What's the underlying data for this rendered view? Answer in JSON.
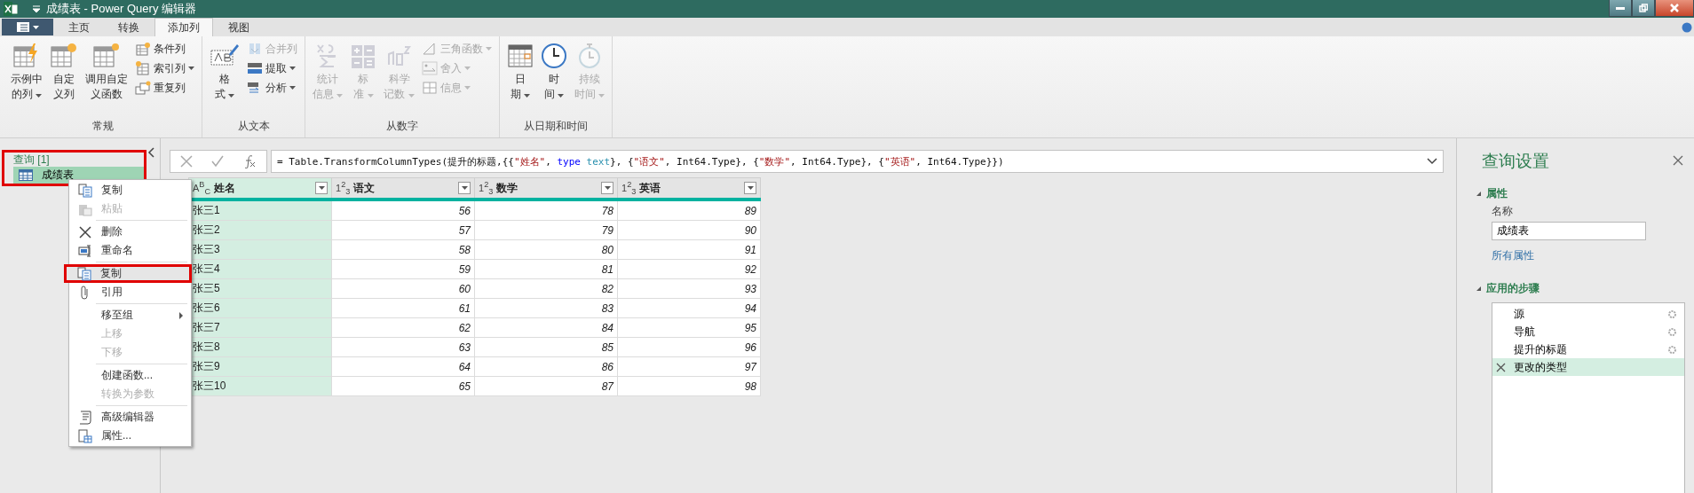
{
  "window": {
    "title": "成绩表 - Power Query 编辑器"
  },
  "ribbon_tabs": [
    {
      "label": "主页",
      "selected": false
    },
    {
      "label": "转换",
      "selected": false
    },
    {
      "label": "添加列",
      "selected": true
    },
    {
      "label": "视图",
      "selected": false
    }
  ],
  "ribbon_groups": [
    {
      "label": "常规",
      "large_buttons": [
        {
          "lines": [
            "示例中",
            "的列"
          ],
          "dropdown": true,
          "disabled": false
        },
        {
          "lines": [
            "自定",
            "义列"
          ],
          "dropdown": false,
          "disabled": false
        },
        {
          "lines": [
            "调用自定",
            "义函数"
          ],
          "dropdown": false,
          "disabled": false
        }
      ],
      "small_buttons": [
        {
          "label": "条件列",
          "dropdown": false,
          "disabled": false
        },
        {
          "label": "索引列",
          "dropdown": true,
          "disabled": false
        },
        {
          "label": "重复列",
          "dropdown": false,
          "disabled": false
        }
      ]
    },
    {
      "label": "从文本",
      "large_buttons": [
        {
          "lines": [
            "格",
            "式"
          ],
          "dropdown": true,
          "disabled": false
        }
      ],
      "small_buttons": [
        {
          "label": "合并列",
          "dropdown": false,
          "disabled": true
        },
        {
          "label": "提取",
          "dropdown": true,
          "disabled": false
        },
        {
          "label": "分析",
          "dropdown": true,
          "disabled": false
        }
      ]
    },
    {
      "label": "从数字",
      "large_buttons": [
        {
          "lines": [
            "统计",
            "信息"
          ],
          "dropdown": true,
          "disabled": true
        },
        {
          "lines": [
            "标",
            "准"
          ],
          "dropdown": true,
          "disabled": true
        },
        {
          "lines": [
            "科学",
            "记数"
          ],
          "dropdown": true,
          "disabled": true
        }
      ],
      "small_buttons": [
        {
          "label": "三角函数",
          "dropdown": true,
          "disabled": true
        },
        {
          "label": "舍入",
          "dropdown": true,
          "disabled": true
        },
        {
          "label": "信息",
          "dropdown": true,
          "disabled": true
        }
      ]
    },
    {
      "label": "从日期和时间",
      "large_buttons": [
        {
          "lines": [
            "日",
            "期"
          ],
          "dropdown": true,
          "disabled": false
        },
        {
          "lines": [
            "时",
            "间"
          ],
          "dropdown": true,
          "disabled": false
        },
        {
          "lines": [
            "持续",
            "时间"
          ],
          "dropdown": true,
          "disabled": true
        }
      ]
    }
  ],
  "queries_pane": {
    "header": "查询 [1]",
    "highlighted": true,
    "items": [
      {
        "label": "成绩表",
        "selected": true
      }
    ]
  },
  "context_menu": {
    "items": [
      {
        "kind": "item",
        "label": "复制",
        "disabled": false,
        "highlighted": false,
        "submenu": false
      },
      {
        "kind": "item",
        "label": "粘贴",
        "disabled": true,
        "highlighted": false,
        "submenu": false
      },
      {
        "kind": "separator"
      },
      {
        "kind": "item",
        "label": "删除",
        "disabled": false,
        "highlighted": false,
        "submenu": false
      },
      {
        "kind": "item",
        "label": "重命名",
        "disabled": false,
        "highlighted": false,
        "submenu": false
      },
      {
        "kind": "separator"
      },
      {
        "kind": "item",
        "label": "复制",
        "disabled": false,
        "highlighted": true,
        "submenu": false
      },
      {
        "kind": "item",
        "label": "引用",
        "disabled": false,
        "highlighted": false,
        "submenu": false
      },
      {
        "kind": "separator"
      },
      {
        "kind": "item",
        "label": "移至组",
        "disabled": false,
        "highlighted": false,
        "submenu": true
      },
      {
        "kind": "item",
        "label": "上移",
        "disabled": true,
        "highlighted": false,
        "submenu": false
      },
      {
        "kind": "item",
        "label": "下移",
        "disabled": true,
        "highlighted": false,
        "submenu": false
      },
      {
        "kind": "separator"
      },
      {
        "kind": "item",
        "label": "创建函数...",
        "disabled": false,
        "highlighted": false,
        "submenu": false
      },
      {
        "kind": "item",
        "label": "转换为参数",
        "disabled": true,
        "highlighted": false,
        "submenu": false
      },
      {
        "kind": "separator"
      },
      {
        "kind": "item",
        "label": "高级编辑器",
        "disabled": false,
        "highlighted": false,
        "submenu": false
      },
      {
        "kind": "item",
        "label": "属性...",
        "disabled": false,
        "highlighted": false,
        "submenu": false
      }
    ]
  },
  "formula_bar": {
    "segments": [
      {
        "kind": "plain",
        "text": "= Table.TransformColumnTypes(提升的标题,{{"
      },
      {
        "kind": "string",
        "text": "\"姓名\""
      },
      {
        "kind": "plain",
        "text": ", "
      },
      {
        "kind": "keyword",
        "text": "type "
      },
      {
        "kind": "typename",
        "text": "text"
      },
      {
        "kind": "plain",
        "text": "}, {"
      },
      {
        "kind": "string",
        "text": "\"语文\""
      },
      {
        "kind": "plain",
        "text": ", Int64.Type}, {"
      },
      {
        "kind": "string",
        "text": "\"数学\""
      },
      {
        "kind": "plain",
        "text": ", Int64.Type}, {"
      },
      {
        "kind": "string",
        "text": "\"英语\""
      },
      {
        "kind": "plain",
        "text": ", Int64.Type}})"
      }
    ]
  },
  "table": {
    "columns": [
      {
        "type_mark": "A$^{B}$$_{C}$",
        "label": "姓名",
        "selected": true
      },
      {
        "type_mark": "1$^{2}$$_{3}$",
        "label": "语文",
        "selected": false
      },
      {
        "type_mark": "1$^{2}$$_{3}$",
        "label": "数学",
        "selected": false
      },
      {
        "type_mark": "1$^{2}$$_{3}$",
        "label": "英语",
        "selected": false
      }
    ],
    "rows": [
      [
        "张三1",
        "56",
        "78",
        "89"
      ],
      [
        "张三2",
        "57",
        "79",
        "90"
      ],
      [
        "张三3",
        "58",
        "80",
        "91"
      ],
      [
        "张三4",
        "59",
        "81",
        "92"
      ],
      [
        "张三5",
        "60",
        "82",
        "93"
      ],
      [
        "张三6",
        "61",
        "83",
        "94"
      ],
      [
        "张三7",
        "62",
        "84",
        "95"
      ],
      [
        "张三8",
        "63",
        "85",
        "96"
      ],
      [
        "张三9",
        "64",
        "86",
        "97"
      ],
      [
        "张三10",
        "65",
        "87",
        "98"
      ]
    ]
  },
  "query_settings": {
    "title": "查询设置",
    "properties": {
      "label": "属性",
      "expanded": true,
      "name_label": "名称",
      "name_value": "成绩表",
      "all_properties_link": "所有属性"
    },
    "steps_section": {
      "label": "应用的步骤",
      "expanded": true
    },
    "steps": [
      {
        "label": "源",
        "selected": false,
        "has_settings": true
      },
      {
        "label": "导航",
        "selected": false,
        "has_settings": true
      },
      {
        "label": "提升的标题",
        "selected": false,
        "has_settings": true
      },
      {
        "label": "更改的类型",
        "selected": true,
        "has_settings": false
      }
    ]
  }
}
